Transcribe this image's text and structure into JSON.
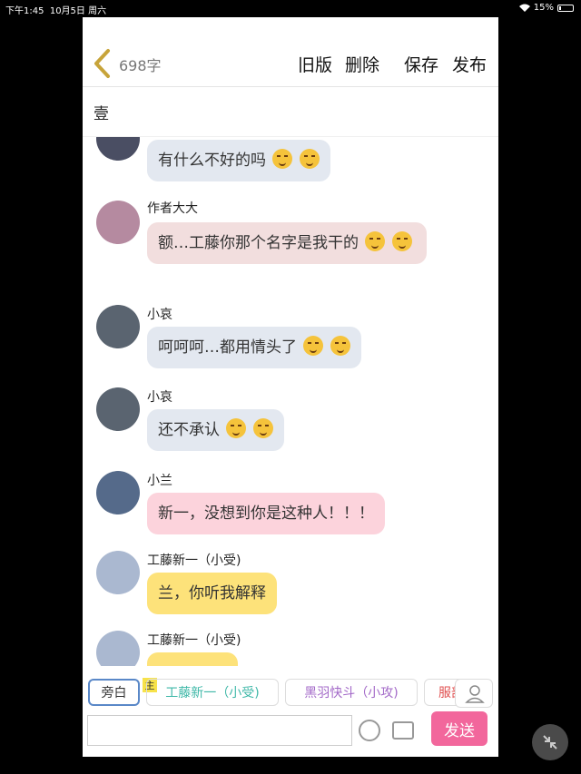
{
  "status": {
    "time": "下午1:45",
    "date": "10月5日 周六",
    "battery": "15%"
  },
  "header": {
    "count": "698字",
    "actions": [
      "旧版",
      "删除",
      "保存",
      "发布"
    ]
  },
  "chapter_title": "壹",
  "messages": [
    {
      "name": "",
      "text": "有什么不好的吗",
      "emojis": 2,
      "bg": "#e3e8f0",
      "avatar_color": "#4a4e63"
    },
    {
      "name": "作者大大",
      "text": "额…工藤你那个名字是我干的",
      "emojis": 2,
      "bg": "#f2dede",
      "avatar_color": "#b58aa0"
    },
    {
      "name": "小哀",
      "text": "呵呵呵…都用情头了",
      "emojis": 2,
      "bg": "#e3e8f0",
      "avatar_color": "#5a6470"
    },
    {
      "name": "小哀",
      "text": "还不承认",
      "emojis": 2,
      "bg": "#e3e8f0",
      "avatar_color": "#5a6470"
    },
    {
      "name": "小兰",
      "text": "新一，没想到你是这种人！！！",
      "emojis": 0,
      "bg": "#fcd3dc",
      "avatar_color": "#556a8a"
    },
    {
      "name": "工藤新一（小受)",
      "text": "兰，你听我解释",
      "emojis": 0,
      "bg": "#fde27a",
      "avatar_color": "#aab8d0"
    },
    {
      "name": "工藤新一（小受)",
      "text": "",
      "emojis": 0,
      "bg": "#fde27a",
      "avatar_color": "#aab8d0"
    }
  ],
  "roles": {
    "narration": "旁白",
    "main_tag": "主",
    "items": [
      {
        "label": "工藤新一（小受)",
        "color": "#3fb8a8"
      },
      {
        "label": "黑羽快斗（小攻)",
        "color": "#a36ac8"
      },
      {
        "label": "服部",
        "color": "#e05050"
      }
    ]
  },
  "input": {
    "placeholder": "",
    "send_label": "发送"
  }
}
